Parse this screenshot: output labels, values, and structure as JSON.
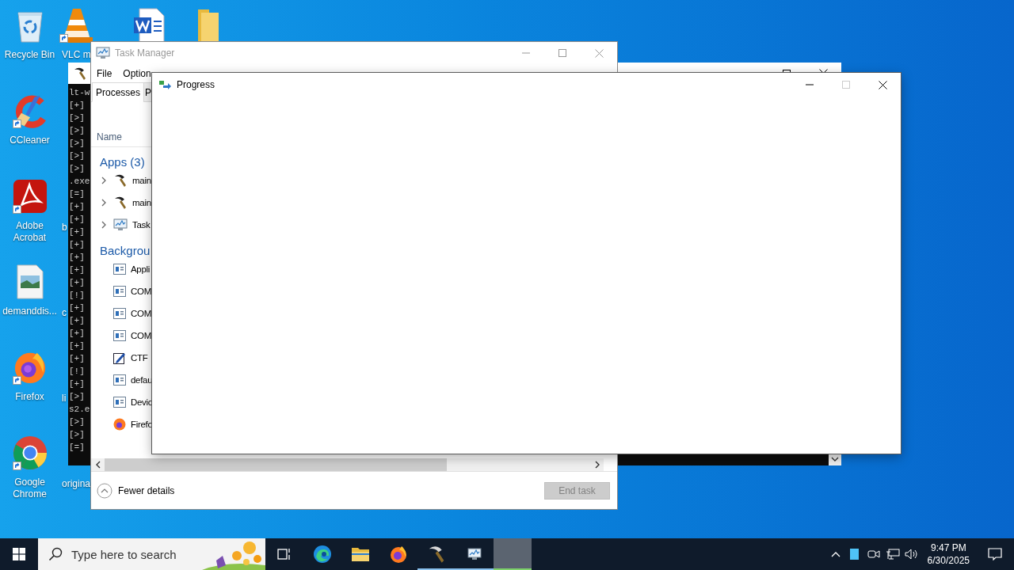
{
  "desktop_icons": [
    {
      "label": "Recycle Bin",
      "kind": "recycle_bin",
      "shortcut": false
    },
    {
      "label": "VLC m",
      "kind": "vlc",
      "shortcut": true
    },
    {
      "kind": "word_doc",
      "shortcut": false
    },
    {
      "kind": "folder",
      "shortcut": false
    },
    {
      "label": "CCleaner",
      "kind": "ccleaner",
      "shortcut": true
    },
    {
      "label": "Adobe Acrobat",
      "kind": "acrobat",
      "shortcut": true
    },
    {
      "label": "b",
      "kind": "hidden"
    },
    {
      "label": "demanddis...",
      "kind": "image_file",
      "shortcut": false
    },
    {
      "label": "c",
      "kind": "hidden"
    },
    {
      "label": "Firefox",
      "kind": "firefox",
      "shortcut": true
    },
    {
      "label": "li",
      "kind": "hidden"
    },
    {
      "label": "Google Chrome",
      "kind": "chrome",
      "shortcut": true
    },
    {
      "label": "origina",
      "kind": "hidden"
    }
  ],
  "console": {
    "lines": [
      "lt-w",
      "[+]",
      "[>]",
      "[>]",
      "[>]",
      "[>]",
      "[>]",
      ".exe",
      "[=]",
      "[+]",
      "[+]",
      "[+]",
      "[+]",
      "[+]",
      "[+]",
      "[+]",
      "[!]",
      "[+]",
      "[+]",
      "[+]",
      "[+]",
      "[+]",
      "[!]",
      "[+]",
      "[>]",
      "s2.e",
      "[>]",
      "[>]",
      "[=]"
    ]
  },
  "task_manager": {
    "title": "Task Manager",
    "menu": [
      "File",
      "Option"
    ],
    "tabs": [
      {
        "label": "Processes",
        "selected": true
      },
      {
        "label": "P",
        "selected": false
      }
    ],
    "column_header": "Name",
    "groups": [
      {
        "title": "Apps (3)",
        "rows": [
          {
            "name": "main",
            "kind": "hammer",
            "expandable": true
          },
          {
            "name": "main",
            "kind": "hammer",
            "expandable": true
          },
          {
            "name": "Task",
            "kind": "task_manager",
            "expandable": true
          }
        ]
      },
      {
        "title": "Backgrou",
        "rows": [
          {
            "name": "Appli",
            "kind": "service",
            "expandable": false
          },
          {
            "name": "COM",
            "kind": "service",
            "expandable": false
          },
          {
            "name": "COM",
            "kind": "service",
            "expandable": false
          },
          {
            "name": "COM",
            "kind": "service",
            "expandable": false
          },
          {
            "name": "CTF",
            "kind": "ctf",
            "expandable": false
          },
          {
            "name": "defau",
            "kind": "service",
            "expandable": false
          },
          {
            "name": "Devic",
            "kind": "service",
            "expandable": false
          },
          {
            "name": "Firefo",
            "kind": "firefox",
            "expandable": false
          }
        ]
      }
    ],
    "details_toggle": "Fewer details",
    "end_task": {
      "label": "End task",
      "disabled": true
    }
  },
  "progress_window": {
    "title": "Progress"
  },
  "taskbar": {
    "search": {
      "placeholder": "Type here to search"
    },
    "apps": [
      {
        "kind": "task_view",
        "running": false,
        "selected": false
      },
      {
        "kind": "edge",
        "running": false,
        "selected": false
      },
      {
        "kind": "explorer",
        "running": false,
        "selected": false
      },
      {
        "kind": "firefox",
        "running": false,
        "selected": false
      },
      {
        "kind": "hammer",
        "running": true,
        "selected": false
      },
      {
        "kind": "task_manager",
        "running": true,
        "selected": false
      },
      {
        "kind": "blank",
        "running": true,
        "selected": true
      }
    ],
    "time": "9:47 PM",
    "date": "6/30/2025"
  }
}
